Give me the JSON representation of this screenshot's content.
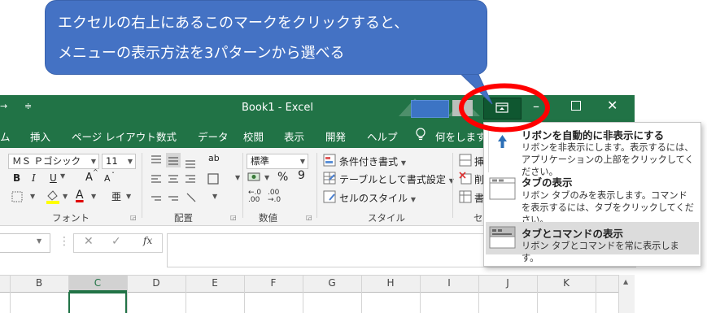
{
  "callout": {
    "line1": "エクセルの右上にあるこのマークをクリックすると、",
    "line2": "メニューの表示方法を3パターンから選べる"
  },
  "titlebar": {
    "title": "Book1  -  Excel",
    "qat_arrow": "→",
    "qat_dropdown": "≑"
  },
  "tabs": [
    "ム",
    "挿入",
    "ページ レイアウト",
    "数式",
    "データ",
    "校閲",
    "表示",
    "開発",
    "ヘルプ",
    "何をしますか"
  ],
  "ribbon": {
    "font_name": "ＭＳ Ｐゴシック",
    "font_size": "11",
    "bold": "B",
    "italic": "I",
    "underline": "U",
    "grow_font": "A",
    "shrink_font": "A",
    "number_format": "標準",
    "percent": "%",
    "comma": "9",
    "conditional_formatting": "条件付き書式",
    "format_as_table": "テーブルとして書式設定",
    "cell_styles": "セルのスタイル",
    "insert_partial": "挿",
    "delete_partial": "削",
    "format_partial": "書",
    "groups": [
      "フォント",
      "配置",
      "数値",
      "スタイル",
      "セ"
    ]
  },
  "formula": {
    "cancel": "✕",
    "enter": "✓",
    "fx": "fx"
  },
  "columns": [
    "B",
    "C",
    "D",
    "E",
    "F",
    "G",
    "H",
    "I",
    "J",
    "K"
  ],
  "menu": {
    "items": [
      {
        "title": "リボンを自動的に非表示にする",
        "desc": "リボンを非表示にします。表示するには、アプリケーションの上部をクリックしてください。"
      },
      {
        "title": "タブの表示",
        "desc": "リボン タブのみを表示します。コマンドを表示するには、タブをクリックしてください。"
      },
      {
        "title": "タブとコマンドの表示",
        "desc": "リボン タブとコマンドを常に表示します。"
      }
    ]
  },
  "colors": {
    "excel_green": "#217346",
    "callout_blue": "#4472c4",
    "highlight_red": "#ff0000"
  }
}
